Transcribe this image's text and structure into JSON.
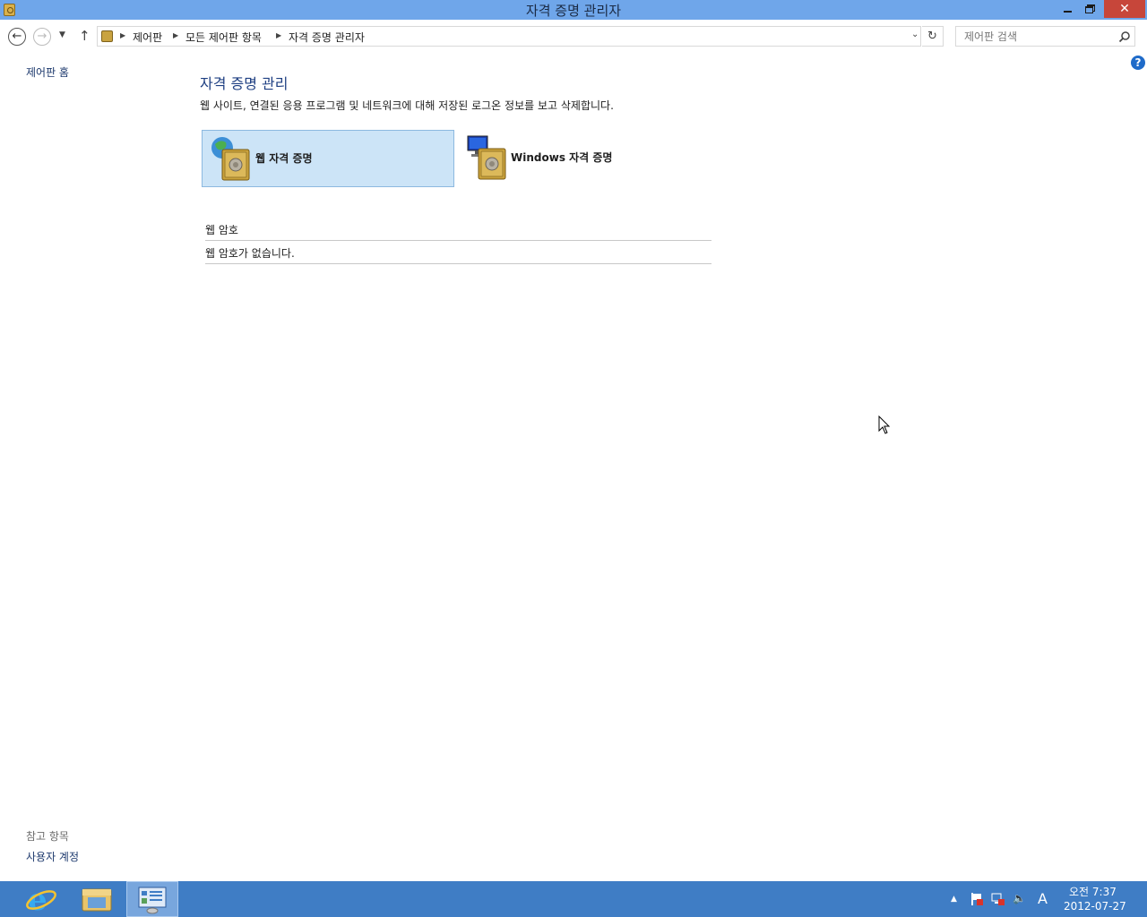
{
  "window": {
    "title": "자격 증명 관리자",
    "minimize_icon": "minimize-icon",
    "maximize_icon": "restore-icon",
    "close_glyph": "✕"
  },
  "nav": {
    "breadcrumb": [
      "제어판",
      "모든 제어판 항목",
      "자격 증명 관리자"
    ],
    "search_placeholder": "제어판 검색"
  },
  "sidebar": {
    "home_link": "제어판 홈",
    "see_also_heading": "참고 항목",
    "see_also_links": [
      "사용자 계정"
    ]
  },
  "main": {
    "title": "자격 증명 관리",
    "description": "웹 사이트, 연결된 응용 프로그램 및 네트워크에 대해 저장된 로그온 정보를 보고 삭제합니다.",
    "tiles": [
      {
        "label": "웹 자격 증명",
        "icon": "web-vault-icon",
        "selected": true
      },
      {
        "label": "Windows 자격 증명",
        "icon": "windows-vault-icon",
        "selected": false
      }
    ],
    "section_heading": "웹 암호",
    "empty_message": "웹 암호가 없습니다."
  },
  "taskbar": {
    "pinned": [
      "internet-explorer-icon",
      "file-explorer-icon",
      "control-panel-icon"
    ],
    "active": "control-panel-icon",
    "tray_ime": "A",
    "clock_time": "오전 7:37",
    "clock_date": "2012-07-27"
  },
  "colors": {
    "titlebar": "#6fa6ea",
    "close_button": "#c7463a",
    "taskbar": "#3f7dc5",
    "selected_tile": "#cce4f7",
    "link": "#1e3a6e",
    "heading": "#1e3f82"
  }
}
